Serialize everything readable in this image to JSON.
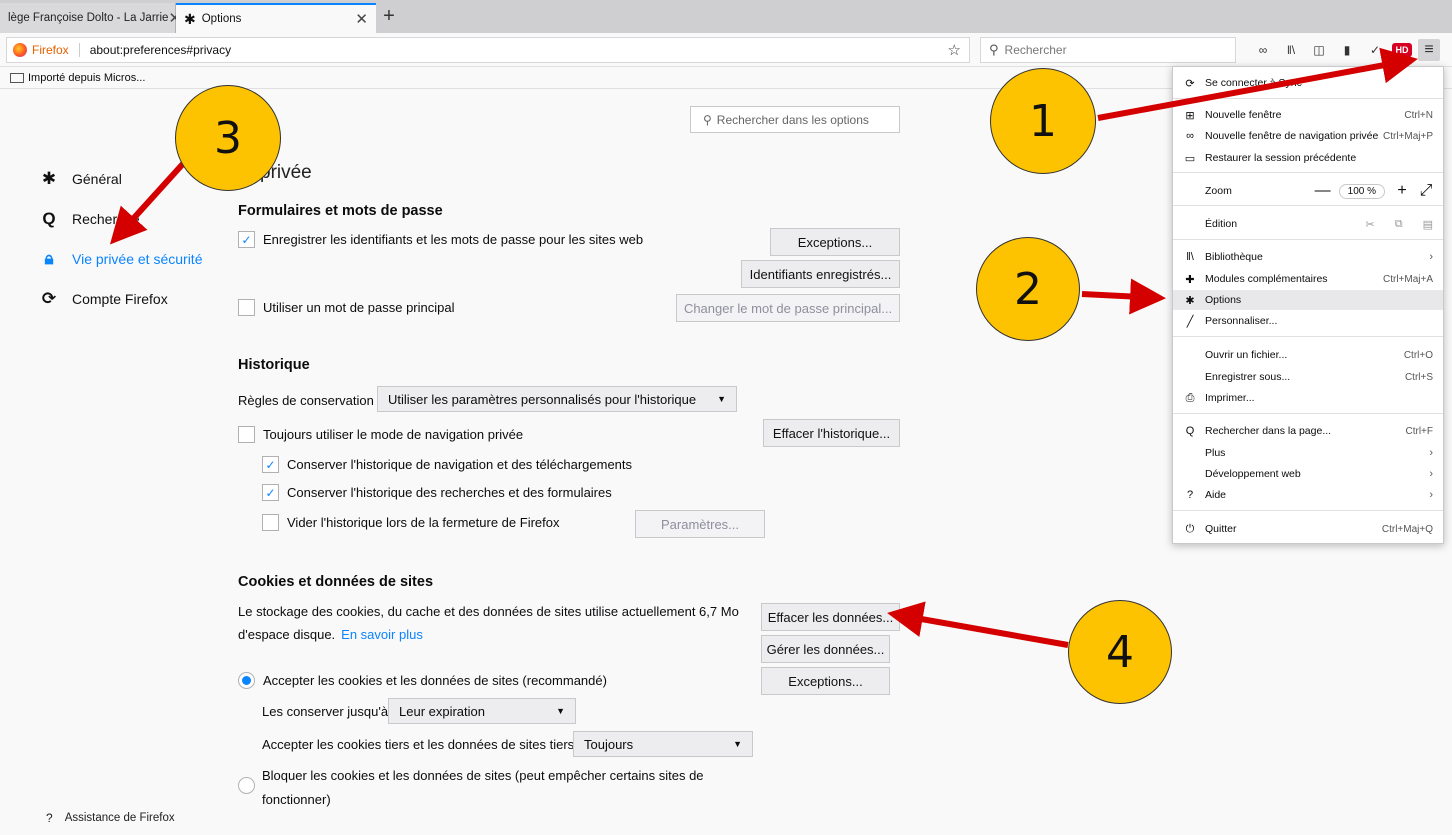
{
  "tabs": [
    {
      "label": "lège Françoise Dolto - La Jarrie",
      "close": "✕"
    },
    {
      "label": "Options",
      "close": "✕"
    }
  ],
  "new_tab": "+",
  "urlbar": {
    "brand": "Firefox",
    "url": "about:preferences#privacy",
    "star": "☆"
  },
  "searchbar": {
    "placeholder": "Rechercher"
  },
  "bookmarks": {
    "item": "Importé depuis Micros..."
  },
  "sidebar": {
    "items": [
      {
        "label": "Général",
        "icon": "gear-icon"
      },
      {
        "label": "Recherche",
        "icon": "search-icon"
      },
      {
        "label": "Vie privée et sécurité",
        "icon": "lock-icon"
      },
      {
        "label": "Compte Firefox",
        "icon": "sync-icon"
      }
    ],
    "help": "Assistance de Firefox"
  },
  "options_search": {
    "placeholder": "Rechercher dans les options"
  },
  "page_title": "privée",
  "forms": {
    "heading": "Formulaires et mots de passe",
    "save_logins": "Enregistrer les identifiants et les mots de passe pour les sites web",
    "exceptions_btn": "Exceptions...",
    "saved_logins_btn": "Identifiants enregistrés...",
    "master_pw": "Utiliser un mot de passe principal",
    "change_master_btn": "Changer le mot de passe principal..."
  },
  "history": {
    "heading": "Historique",
    "rules_label": "Règles de conservation",
    "rules_value": "Utiliser les paramètres personnalisés pour l'historique",
    "always_private": "Toujours utiliser le mode de navigation privée",
    "clear_btn": "Effacer l'historique...",
    "keep_browsing": "Conserver l'historique de navigation et des téléchargements",
    "keep_search": "Conserver l'historique des recherches et des formulaires",
    "clear_on_close": "Vider l'historique lors de la fermeture de Firefox",
    "settings_btn": "Paramètres..."
  },
  "cookies": {
    "heading": "Cookies et données de sites",
    "desc_line1": "Le stockage des cookies, du cache et des données de sites utilise actuellement 6,7 Mo",
    "desc_line2": "d'espace disque.",
    "learn_more": "En savoir plus",
    "clear_btn": "Effacer les données...",
    "manage_btn": "Gérer les données...",
    "exceptions_btn": "Exceptions...",
    "accept": "Accepter les cookies et les données de sites (recommandé)",
    "keep_until_label": "Les conserver jusqu'à",
    "keep_until_value": "Leur expiration",
    "third_party_label": "Accepter les cookies tiers et les données de sites tiers",
    "third_party_value": "Toujours",
    "block_line1": "Bloquer les cookies et les données de sites (peut empêcher certains sites de",
    "block_line2": "fonctionner)"
  },
  "appmenu": {
    "sync": "Se connecter à Sync",
    "new_window": {
      "label": "Nouvelle fenêtre",
      "shortcut": "Ctrl+N"
    },
    "private_window": {
      "label": "Nouvelle fenêtre de navigation privée",
      "shortcut": "Ctrl+Maj+P"
    },
    "restore": "Restaurer la session précédente",
    "zoom": {
      "label": "Zoom",
      "minus": "—",
      "value": "100 %",
      "plus": "+"
    },
    "edit": "Édition",
    "library": "Bibliothèque",
    "addons": {
      "label": "Modules complémentaires",
      "shortcut": "Ctrl+Maj+A"
    },
    "options": "Options",
    "customize": "Personnaliser...",
    "open_file": {
      "label": "Ouvrir un fichier...",
      "shortcut": "Ctrl+O"
    },
    "save_as": {
      "label": "Enregistrer sous...",
      "shortcut": "Ctrl+S"
    },
    "print": "Imprimer...",
    "find": {
      "label": "Rechercher dans la page...",
      "shortcut": "Ctrl+F"
    },
    "more": "Plus",
    "webdev": "Développement web",
    "help": "Aide",
    "quit": {
      "label": "Quitter",
      "shortcut": "Ctrl+Maj+Q"
    }
  },
  "annotations": [
    "1",
    "2",
    "3",
    "4"
  ],
  "colors": {
    "accent": "#0a84ff",
    "annotation_fill": "#fdc300",
    "arrow": "#d40000"
  }
}
